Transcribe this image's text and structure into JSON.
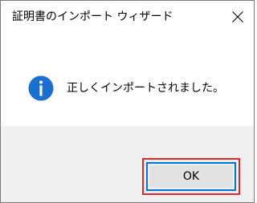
{
  "window": {
    "title": "証明書のインポート ウィザード",
    "close_icon": "close-icon"
  },
  "content": {
    "icon": "info-icon",
    "message": "正しくインポートされました。"
  },
  "footer": {
    "ok_label": "OK"
  },
  "colors": {
    "info_icon": "#1a6fd0",
    "footer_bg": "#f0f0f0",
    "button_focus_border": "#0078d7",
    "highlight_border": "#e0262e"
  }
}
